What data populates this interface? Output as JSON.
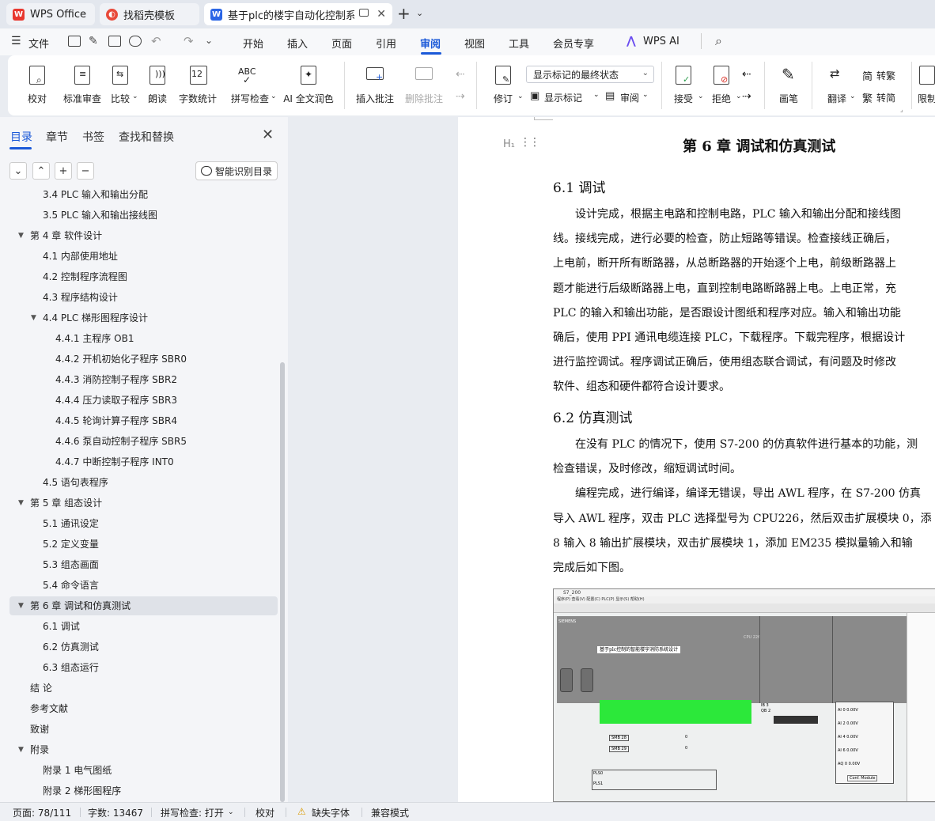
{
  "tabs": [
    {
      "label": "WPS Office",
      "icon": "wps-logo-icon"
    },
    {
      "label": "找稻壳模板",
      "icon": "docer-icon"
    },
    {
      "label": "基于plc的楼宇自动化控制系统",
      "icon": "word-doc-icon"
    }
  ],
  "menubar": {
    "file_label": "文件",
    "items": [
      "开始",
      "插入",
      "页面",
      "引用",
      "审阅",
      "视图",
      "工具",
      "会员专享"
    ],
    "active": "审阅",
    "ai_label": "WPS AI"
  },
  "ribbon": {
    "proofread": "校对",
    "standard_review": "标准审查",
    "compare": "比较",
    "read_aloud": "朗读",
    "word_count": "字数统计",
    "spell_check": "拼写检查",
    "ai_polish": "AI 全文润色",
    "insert_comment": "插入批注",
    "delete_comment": "删除批注",
    "track_changes": "修订",
    "markup_select_value": "显示标记的最终状态",
    "show_markup": "显示标记",
    "review_pane": "审阅",
    "accept": "接受",
    "reject": "拒绝",
    "ink": "画笔",
    "translate": "翻译",
    "to_traditional": "转繁",
    "to_simplified": "转简",
    "restrict": "限制"
  },
  "sidebar": {
    "tabs": [
      "目录",
      "章节",
      "书签",
      "查找和替换"
    ],
    "active_tab": "目录",
    "ai_toc_label": "智能识别目录",
    "toc": [
      {
        "label": "3.4   PLC 输入和输出分配",
        "level": 2
      },
      {
        "label": "3.5   PLC 输入和输出接线图",
        "level": 2
      },
      {
        "label": "第 4 章   软件设计",
        "level": 1,
        "expanded": true
      },
      {
        "label": "4.1   内部使用地址",
        "level": 2
      },
      {
        "label": "4.2   控制程序流程图",
        "level": 2
      },
      {
        "label": "4.3   程序结构设计",
        "level": 2
      },
      {
        "label": "4.4   PLC 梯形图程序设计",
        "level": 2,
        "expanded": true
      },
      {
        "label": "4.4.1  主程序 OB1",
        "level": 3
      },
      {
        "label": "4.4.2  开机初始化子程序 SBR0",
        "level": 3
      },
      {
        "label": "4.4.3 消防控制子程序 SBR2",
        "level": 3
      },
      {
        "label": "4.4.4  压力读取子程序 SBR3",
        "level": 3
      },
      {
        "label": "4.4.5  轮询计算子程序 SBR4",
        "level": 3
      },
      {
        "label": "4.4.6    泵自动控制子程序 SBR5",
        "level": 3
      },
      {
        "label": "4.4.7    中断控制子程序 INT0",
        "level": 3
      },
      {
        "label": "4.5   语句表程序",
        "level": 2
      },
      {
        "label": "第 5 章  组态设计",
        "level": 1,
        "expanded": true
      },
      {
        "label": "5.1   通讯设定",
        "level": 2
      },
      {
        "label": "5.2   定义变量",
        "level": 2
      },
      {
        "label": "5.3   组态画面",
        "level": 2
      },
      {
        "label": "5.4   命令语言",
        "level": 2
      },
      {
        "label": "第 6 章    调试和仿真测试",
        "level": 1,
        "expanded": true,
        "selected": true
      },
      {
        "label": "6.1   调试",
        "level": 2
      },
      {
        "label": "6.2   仿真测试",
        "level": 2
      },
      {
        "label": "6.3   组态运行",
        "level": 2
      },
      {
        "label": "结   论",
        "level": 1
      },
      {
        "label": "参考文献",
        "level": 1
      },
      {
        "label": "致谢",
        "level": 1
      },
      {
        "label": "附录",
        "level": 1,
        "expanded": true
      },
      {
        "label": "附录 1    电气图纸",
        "level": 2
      },
      {
        "label": "附录 2    梯形图程序",
        "level": 2
      }
    ]
  },
  "document": {
    "chapter_title": "第 6 章    调试和仿真测试",
    "heading_icon": "H₁",
    "section1_title": "6.1    调试",
    "section1_lines": [
      "设计完成，根据主电路和控制电路，PLC 输入和输出分配和接线图",
      "线。接线完成，进行必要的检查，防止短路等错误。检查接线正确后，",
      "上电前，断开所有断路器，从总断路器的开始逐个上电，前级断路器上",
      "题才能进行后级断路器上电，直到控制电路断路器上电。上电正常，充",
      "PLC 的输入和输出功能，是否跟设计图纸和程序对应。输入和输出功能",
      "确后，使用 PPI 通讯电缆连接 PLC，下载程序。下载完程序，根据设计",
      "进行监控调试。程序调试正确后，使用组态联合调试，有问题及时修改",
      "软件、组态和硬件都符合设计要求。"
    ],
    "section2_title": "6.2    仿真测试",
    "section2_lines": [
      "在没有 PLC 的情况下，使用 S7-200 的仿真软件进行基本的功能，测",
      "检查错误，及时修改，缩短调试时间。",
      "编程完成，进行编译，编译无错误，导出 AWL 程序，在 S7-200 仿真",
      "导入 AWL 程序，双击 PLC 选择型号为 CPU226，然后双击扩展模块 0，添",
      "8 输入 8 输出扩展模块，双击扩展模块 1，添加 EM235 模拟量输入和输",
      "完成后如下图。"
    ],
    "section2_indent": [
      true,
      false,
      true,
      false,
      false,
      false
    ],
    "sim_window_title": "S7_200",
    "sim_menu": "程序(P)   查看(V)   配置(C)   PLC(P)   显示(S)   帮助(H)",
    "sim_cpu_label": "CPU 226",
    "sim_panel_title": "基于plc控制的智能楼宇消防系统设计",
    "sim_brand": "SIEMENS",
    "sim_ib": "IB 3",
    "sim_qb": "QB 2",
    "sim_smb28": "SMB 28",
    "sim_smb29": "SMB 29",
    "sim_pls0": "PLS0",
    "sim_pls1": "PLS1",
    "sim_ai_labels": [
      "AI 0",
      "AI 2",
      "AI 4",
      "AI 6",
      "AQ 0"
    ],
    "sim_ai_value": "0.00V",
    "sim_conf_module": "Conf. Module",
    "sim_slider_value": "0"
  },
  "statusbar": {
    "page": "页面: 78/111",
    "words": "字数: 13467",
    "spell": "拼写检查: 打开",
    "proof": "校对",
    "missing_font": "缺失字体",
    "compat": "兼容模式"
  },
  "colors": {
    "accent": "#1b59d8",
    "wps_red": "#e8372f",
    "word_blue": "#2b66e6"
  }
}
